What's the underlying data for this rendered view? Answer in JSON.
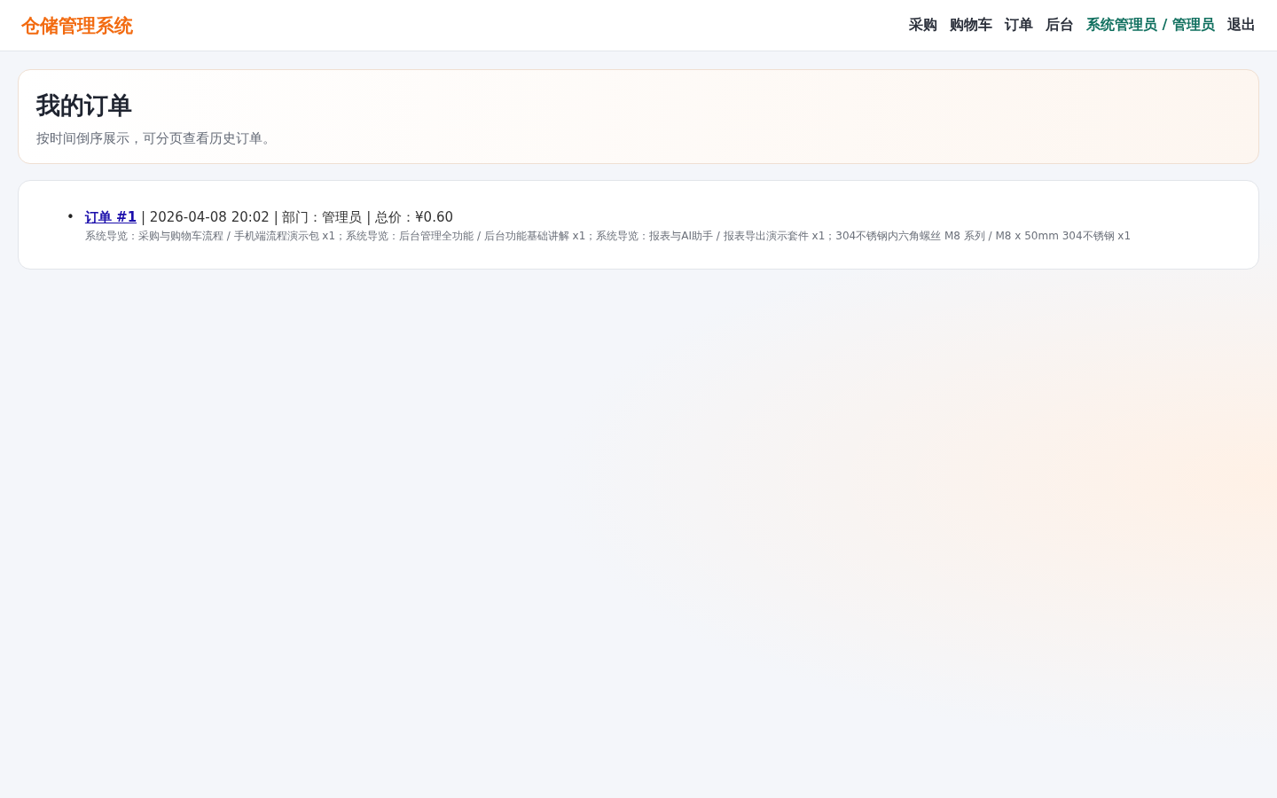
{
  "header": {
    "brand": "仓储管理系统",
    "nav": [
      {
        "kind": "link",
        "label": "采购"
      },
      {
        "kind": "link",
        "label": "购物车"
      },
      {
        "kind": "link",
        "label": "订单"
      },
      {
        "kind": "link",
        "label": "后台"
      },
      {
        "kind": "user",
        "label": "系统管理员 / 管理员"
      },
      {
        "kind": "link",
        "label": "退出"
      }
    ]
  },
  "hero": {
    "title": "我的订单",
    "subtitle": "按时间倒序展示，可分页查看历史订单。"
  },
  "orders": [
    {
      "bullet": "•",
      "link": "订单 #1",
      "summary": "| 2026-04-08 20:02 | 部门：管理员 | 总价：¥0.60",
      "items": "系统导览：采购与购物车流程 / 手机端流程演示包 x1；系统导览：后台管理全功能 / 后台功能基础讲解 x1；系统导览：报表与AI助手 / 报表导出演示套件 x1；304不锈钢内六角螺丝 M8 系列 / M8 x 50mm 304不锈钢 x1"
    }
  ]
}
